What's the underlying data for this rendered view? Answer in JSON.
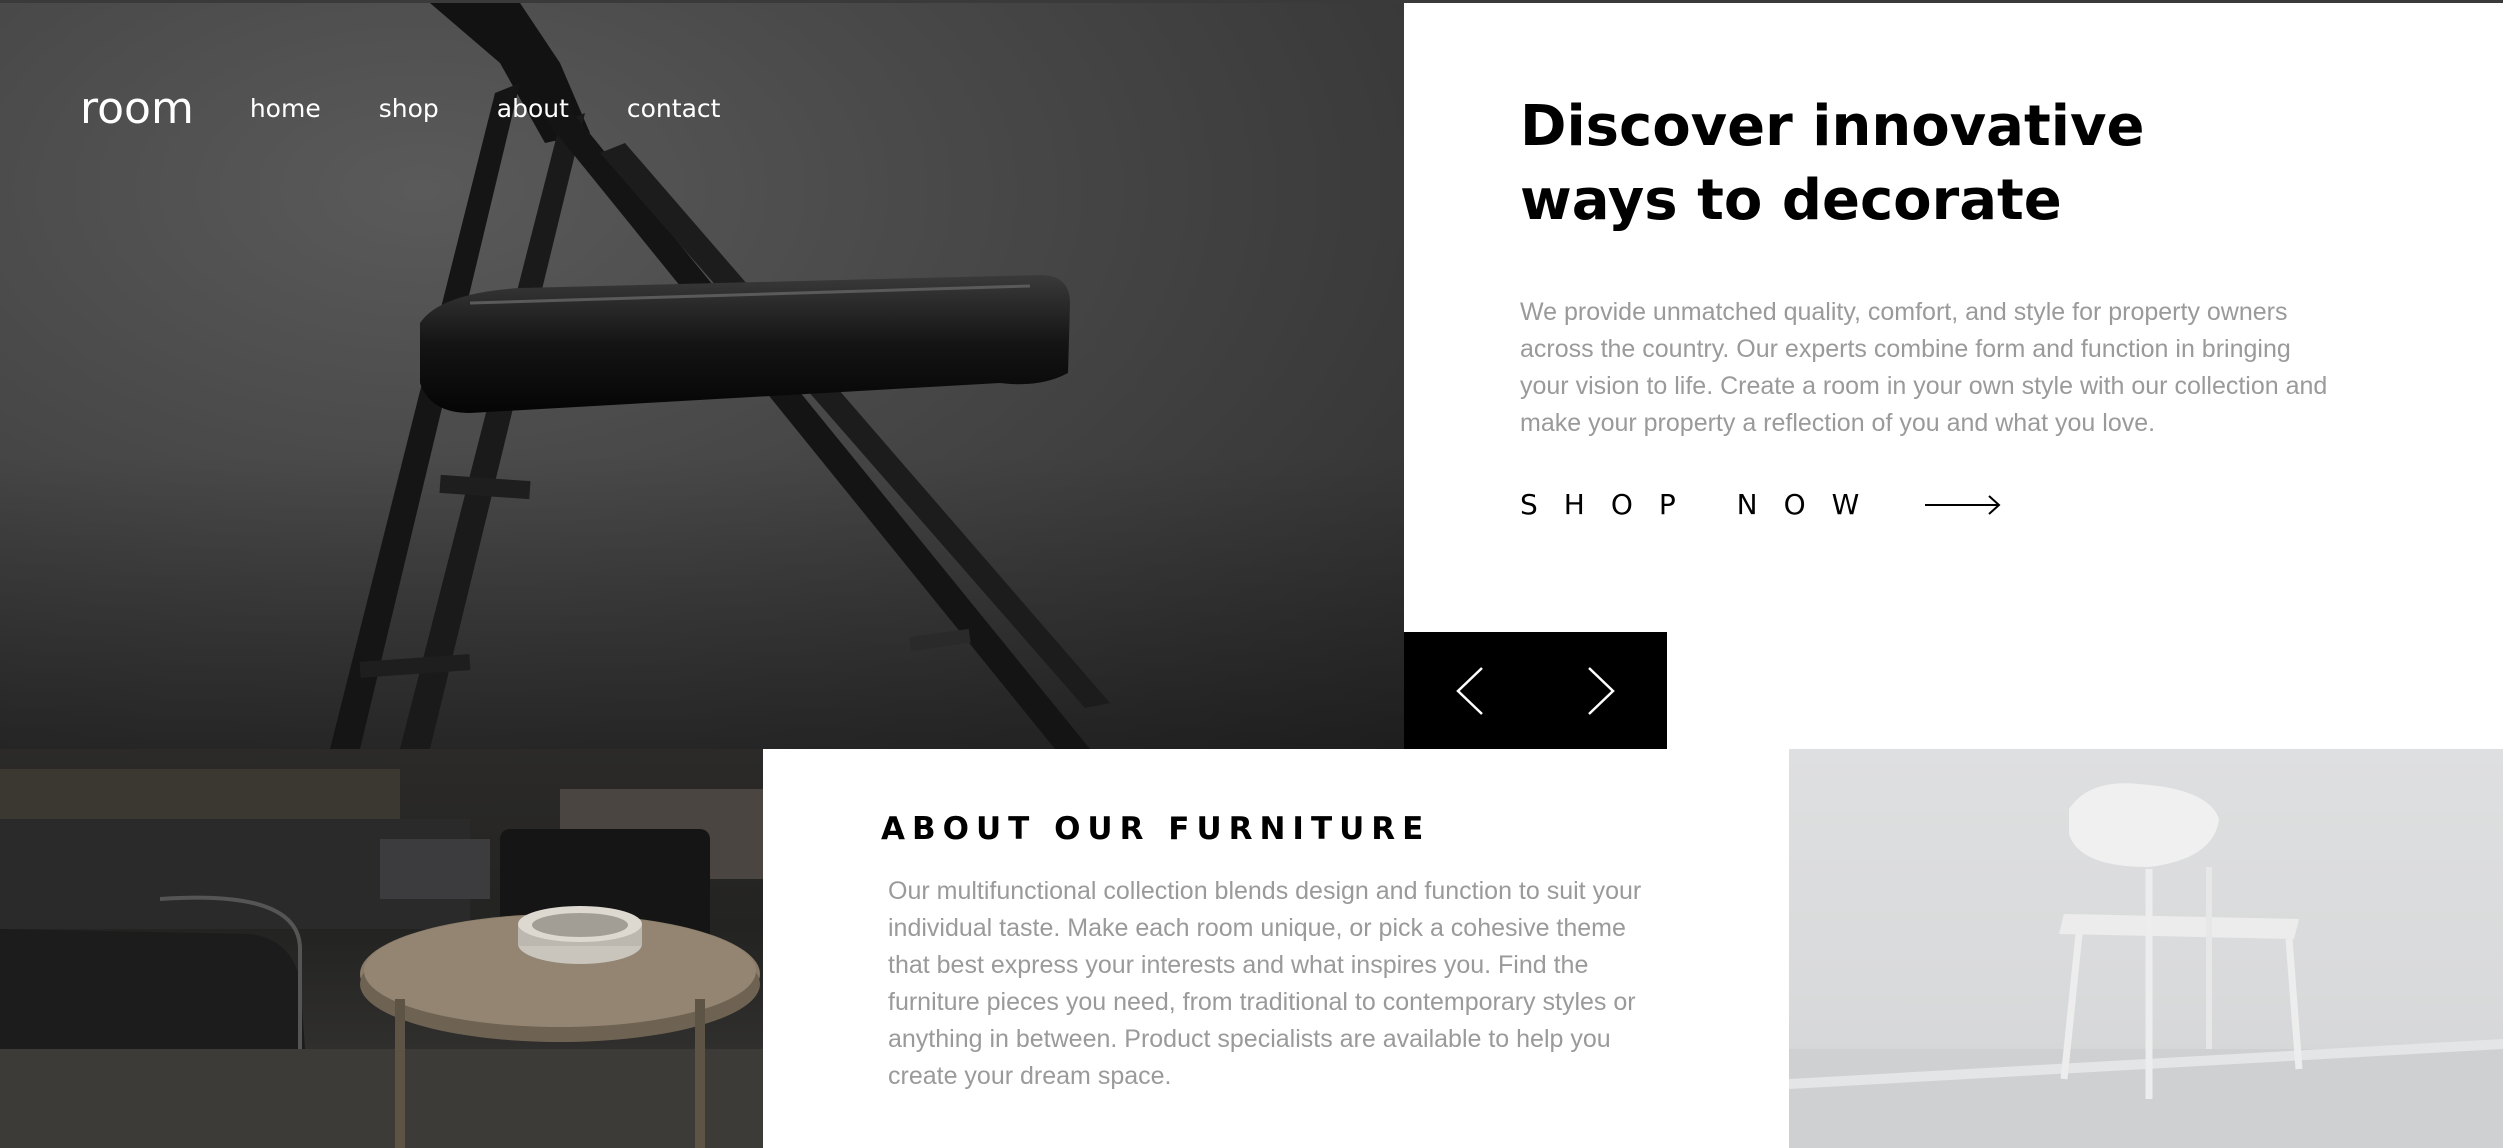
{
  "nav": {
    "logo": "room",
    "links": [
      "home",
      "shop",
      "about",
      "contact"
    ]
  },
  "hero": {
    "title_line1": "Discover innovative",
    "title_line2": "ways to decorate",
    "description": "We provide unmatched quality, comfort, and style for property owners across the country. Our experts combine form and function in bringing your vision to life. Create a room in your own style with our collection and make your property a reflection of you and what you love.",
    "cta_label": "SHOP NOW",
    "cta_icon": "arrow-right-icon"
  },
  "slider": {
    "prev_icon": "chevron-left-icon",
    "next_icon": "chevron-right-icon"
  },
  "about": {
    "title": "ABOUT OUR FURNITURE",
    "description": "Our multifunctional collection blends design and function to suit your individual taste. Make each room unique, or pick a cohesive theme that best express your interests and what inspires you. Find the furniture pieces you need, from traditional to contemporary styles or anything in between. Product specialists are available to help you create your dream space."
  },
  "colors": {
    "text_dark": "#000000",
    "text_muted": "#9a9a9a",
    "slider_bg": "#000000"
  }
}
